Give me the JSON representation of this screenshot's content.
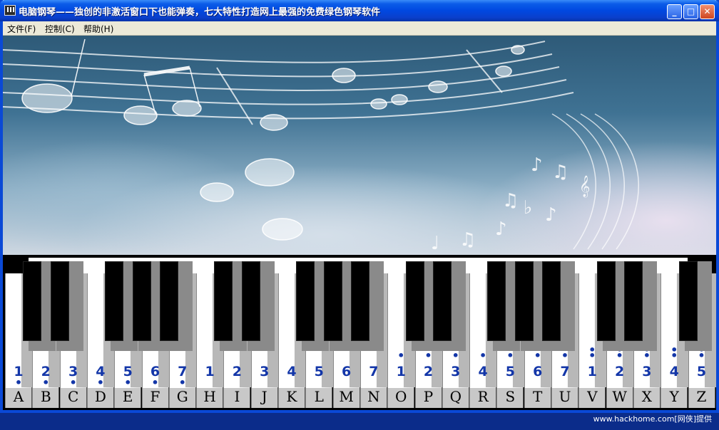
{
  "window": {
    "title": "电脑钢琴——独创的非激活窗口下也能弹奏，七大特性打造网上最强的免费绿色钢琴软件",
    "minimize_label": "_",
    "maximize_label": "□",
    "close_label": "✕"
  },
  "menu": {
    "items": [
      {
        "label": "文件(F)"
      },
      {
        "label": "控制(C)"
      },
      {
        "label": "帮助(H)"
      }
    ]
  },
  "piano": {
    "white_keys": [
      {
        "letter": "A",
        "note": "1",
        "dots": 1,
        "dot_position": "below"
      },
      {
        "letter": "B",
        "note": "2",
        "dots": 1,
        "dot_position": "below"
      },
      {
        "letter": "C",
        "note": "3",
        "dots": 1,
        "dot_position": "below"
      },
      {
        "letter": "D",
        "note": "4",
        "dots": 1,
        "dot_position": "below"
      },
      {
        "letter": "E",
        "note": "5",
        "dots": 1,
        "dot_position": "below"
      },
      {
        "letter": "F",
        "note": "6",
        "dots": 1,
        "dot_position": "below"
      },
      {
        "letter": "G",
        "note": "7",
        "dots": 1,
        "dot_position": "below"
      },
      {
        "letter": "H",
        "note": "1",
        "dots": 0,
        "dot_position": "none"
      },
      {
        "letter": "I",
        "note": "2",
        "dots": 0,
        "dot_position": "none"
      },
      {
        "letter": "J",
        "note": "3",
        "dots": 0,
        "dot_position": "none"
      },
      {
        "letter": "K",
        "note": "4",
        "dots": 0,
        "dot_position": "none"
      },
      {
        "letter": "L",
        "note": "5",
        "dots": 0,
        "dot_position": "none"
      },
      {
        "letter": "M",
        "note": "6",
        "dots": 0,
        "dot_position": "none"
      },
      {
        "letter": "N",
        "note": "7",
        "dots": 0,
        "dot_position": "none"
      },
      {
        "letter": "O",
        "note": "1",
        "dots": 1,
        "dot_position": "above"
      },
      {
        "letter": "P",
        "note": "2",
        "dots": 1,
        "dot_position": "above"
      },
      {
        "letter": "Q",
        "note": "3",
        "dots": 1,
        "dot_position": "above"
      },
      {
        "letter": "R",
        "note": "4",
        "dots": 1,
        "dot_position": "above"
      },
      {
        "letter": "S",
        "note": "5",
        "dots": 1,
        "dot_position": "above"
      },
      {
        "letter": "T",
        "note": "6",
        "dots": 1,
        "dot_position": "above"
      },
      {
        "letter": "U",
        "note": "7",
        "dots": 1,
        "dot_position": "above"
      },
      {
        "letter": "V",
        "note": "1",
        "dots": 2,
        "dot_position": "above"
      },
      {
        "letter": "W",
        "note": "2",
        "dots": 2,
        "dot_position": "above"
      },
      {
        "letter": "X",
        "note": "3",
        "dots": 2,
        "dot_position": "above"
      },
      {
        "letter": "Y",
        "note": "4",
        "dots": 2,
        "dot_position": "above"
      },
      {
        "letter": "Z",
        "note": "5",
        "dots": 2,
        "dot_position": "above"
      }
    ]
  },
  "watermark": "www.hackhome.com[网侠]提供",
  "colors": {
    "title_bar": "#0048e0",
    "note_digit": "#1336a8",
    "frame": "#0a49d6"
  }
}
